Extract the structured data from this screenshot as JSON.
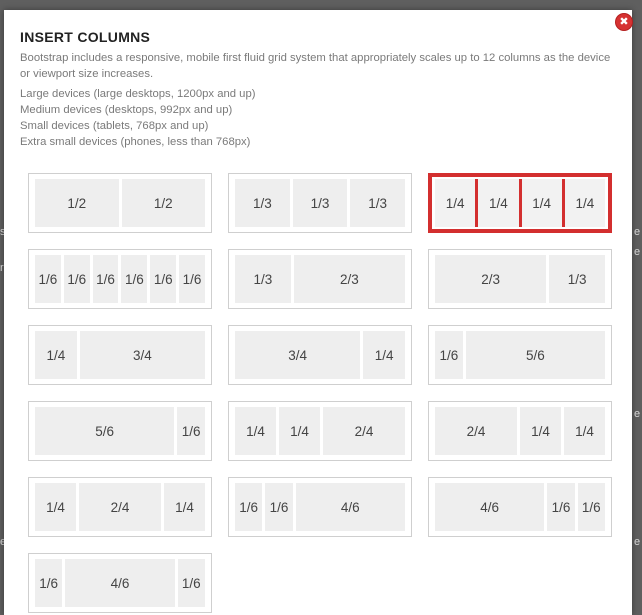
{
  "modal": {
    "title": "INSERT COLUMNS",
    "description": "Bootstrap includes a responsive, mobile first fluid grid system that appropriately scales up to 12 columns as the device or viewport size increases.",
    "devices": [
      "Large devices (large desktops, 1200px and up)",
      "Medium devices (desktops, 992px and up)",
      "Small devices (tablets, 768px and up)",
      "Extra small devices (phones, less than 768px)"
    ],
    "close_icon": "✖"
  },
  "background_fragments": [
    "s",
    "e",
    "r",
    "e",
    "e",
    "e",
    "e"
  ],
  "highlight_color": "#d32f2f",
  "layouts": [
    {
      "cells": [
        "1/2",
        "1/2"
      ]
    },
    {
      "cells": [
        "1/3",
        "1/3",
        "1/3"
      ]
    },
    {
      "cells": [
        "1/4",
        "1/4",
        "1/4",
        "1/4"
      ],
      "selected": true
    },
    {
      "cells": [
        "1/6",
        "1/6",
        "1/6",
        "1/6",
        "1/6",
        "1/6"
      ]
    },
    {
      "cells": [
        "1/3",
        "2/3"
      ]
    },
    {
      "cells": [
        "2/3",
        "1/3"
      ]
    },
    {
      "cells": [
        "1/4",
        "3/4"
      ]
    },
    {
      "cells": [
        "3/4",
        "1/4"
      ]
    },
    {
      "cells": [
        "1/6",
        "5/6"
      ]
    },
    {
      "cells": [
        "5/6",
        "1/6"
      ]
    },
    {
      "cells": [
        "1/4",
        "1/4",
        "2/4"
      ]
    },
    {
      "cells": [
        "2/4",
        "1/4",
        "1/4"
      ]
    },
    {
      "cells": [
        "1/4",
        "2/4",
        "1/4"
      ]
    },
    {
      "cells": [
        "1/6",
        "1/6",
        "4/6"
      ]
    },
    {
      "cells": [
        "4/6",
        "1/6",
        "1/6"
      ]
    },
    {
      "cells": [
        "1/6",
        "4/6",
        "1/6"
      ]
    }
  ]
}
